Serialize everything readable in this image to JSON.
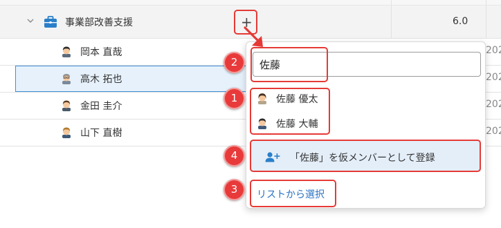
{
  "group": {
    "label": "事業部改善支援",
    "value": "6.0",
    "add_symbol": "+"
  },
  "members": [
    {
      "name": "岡本 直哉",
      "trail": "202"
    },
    {
      "name": "高木 拓也",
      "trail": "202"
    },
    {
      "name": "金田 圭介",
      "trail": "202"
    },
    {
      "name": "山下 直樹",
      "trail": "202"
    }
  ],
  "popup": {
    "search_value": "佐藤",
    "options": [
      {
        "name": "佐藤 優太"
      },
      {
        "name": "佐藤 大輔"
      }
    ],
    "register_label": "「佐藤」を仮メンバーとして登録",
    "list_link_label": "リストから選択"
  },
  "badges": {
    "b1": "1",
    "b2": "2",
    "b3": "3",
    "b4": "4"
  },
  "colors": {
    "annotation_red": "#e53935",
    "selection_blue": "#3f8fd6",
    "link_blue": "#2b73c4",
    "briefcase_blue": "#2a7fc9"
  },
  "icons": {
    "group_icon": "briefcase-icon",
    "expand_icon": "chevron-down-icon",
    "register_icon": "add-user-icon"
  }
}
